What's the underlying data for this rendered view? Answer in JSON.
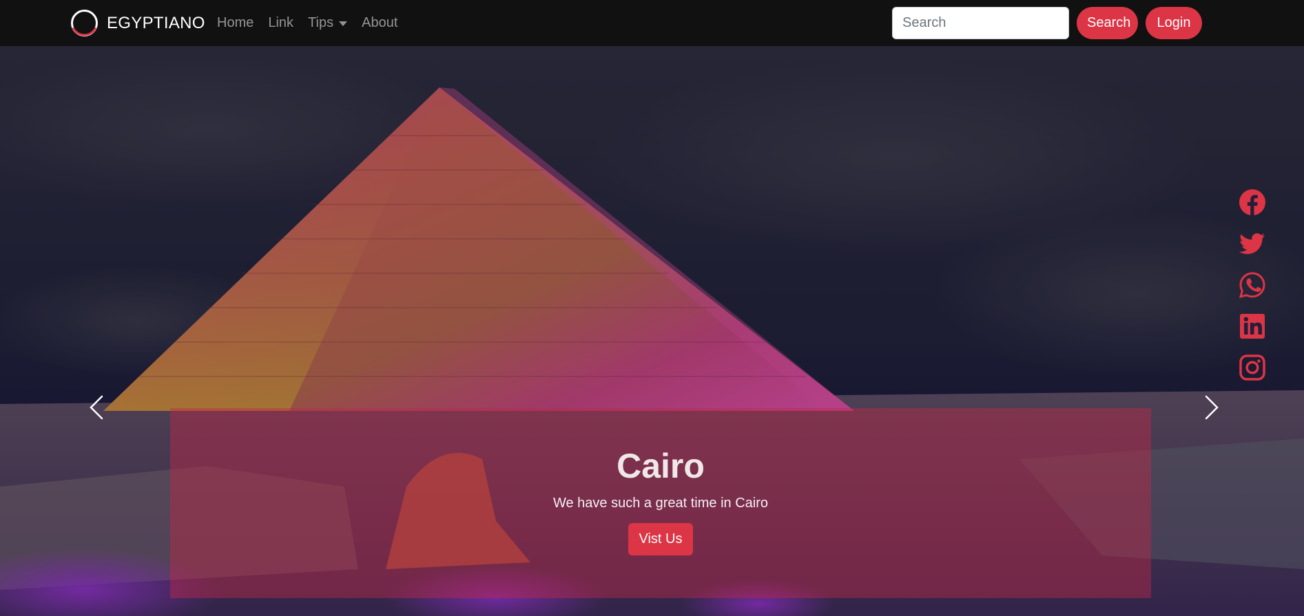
{
  "brand": {
    "name": "EGYPTIANO",
    "logo_icon": "ring-logo-icon"
  },
  "nav": {
    "items": [
      {
        "label": "Home"
      },
      {
        "label": "Link"
      },
      {
        "label": "Tips",
        "has_dropdown": true
      },
      {
        "label": "About"
      }
    ]
  },
  "search": {
    "placeholder": "Search",
    "value": "",
    "button_label": "Search"
  },
  "login": {
    "label": "Login"
  },
  "carousel": {
    "caption_title": "Cairo",
    "caption_text": "We have such a great time in Cairo",
    "caption_button": "Vist Us",
    "prev_icon": "chevron-left-icon",
    "next_icon": "chevron-right-icon"
  },
  "social": [
    {
      "icon": "facebook-icon"
    },
    {
      "icon": "twitter-icon"
    },
    {
      "icon": "whatsapp-icon"
    },
    {
      "icon": "linkedin-icon"
    },
    {
      "icon": "instagram-icon"
    }
  ],
  "colors": {
    "navbar_bg": "#111111",
    "accent": "#dc3545",
    "caption_overlay": "rgba(190,40,70,0.45)"
  }
}
